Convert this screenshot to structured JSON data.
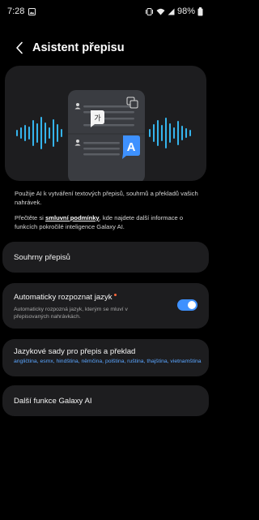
{
  "status_bar": {
    "time": "7:28",
    "battery": "98%",
    "icons": [
      "image-notification-icon",
      "vibrate-icon",
      "wifi-icon",
      "signal-icon",
      "battery-icon"
    ]
  },
  "header": {
    "title": "Asistent přepisu",
    "back_icon": "back-arrow-icon"
  },
  "hero": {
    "bubble_glyph": "가",
    "badge_glyph": "A",
    "icons": [
      "user-icon",
      "translate-icon"
    ]
  },
  "description": {
    "paragraph1": "Použije AI k vytváření textových přepisů, souhrnů a překladů vašich nahrávek.",
    "paragraph2_before": "Přečtěte si ",
    "paragraph2_link": "smluvní podmínky",
    "paragraph2_after": ", kde najdete další informace o funkcích pokročilé inteligence Galaxy AI."
  },
  "settings": {
    "summaries": {
      "title": "Souhrny přepisů"
    },
    "auto_detect": {
      "title": "Automaticky rozpoznat jazyk",
      "subtitle": "Automaticky rozpozná jazyk, kterým se mluví v přepisovaných nahrávkách.",
      "enabled": true
    },
    "language_packs": {
      "title": "Jazykové sady pro přepis a překlad",
      "languages": "angličtina, esmx, hindština, němčina, polština, ruština, thajština, vietnamština"
    },
    "more": {
      "title": "Další funkce Galaxy AI"
    }
  },
  "colors": {
    "background": "#000000",
    "card": "#1d1d1f",
    "accent": "#3e91ff",
    "link_blue": "#5aa5ff",
    "wave": "#35b4ec",
    "new_dot": "#ff6a3d"
  }
}
